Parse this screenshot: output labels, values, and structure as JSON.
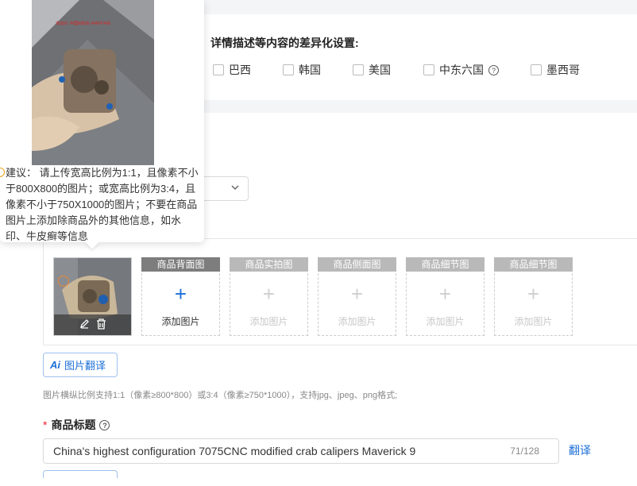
{
  "diff_settings": {
    "title": "详情描述等内容的差异化设置:",
    "countries": [
      {
        "label": "巴西",
        "checked": false
      },
      {
        "label": "韩国",
        "checked": false
      },
      {
        "label": "美国",
        "checked": false
      },
      {
        "label": "中东六国",
        "checked": false
      },
      {
        "label": "墨西哥",
        "checked": false
      }
    ]
  },
  "image_slots": [
    {
      "label": "商品背面图",
      "add_label": "添加图片",
      "active": true
    },
    {
      "label": "商品实拍图",
      "add_label": "添加图片",
      "active": false
    },
    {
      "label": "商品侧面图",
      "add_label": "添加图片",
      "active": false
    },
    {
      "label": "商品细节图",
      "add_label": "添加图片",
      "active": false
    },
    {
      "label": "商品细节图",
      "add_label": "添加图片",
      "active": false
    }
  ],
  "ai_translate": {
    "ai_label": "Ai",
    "label": "图片翻译"
  },
  "image_hint": "图片横纵比例支持1:1（像素≥800*800）或3:4（像素≥750*1000），支持jpg、jpeg、png格式;",
  "product_title": {
    "label": "商品标题",
    "value": "China's highest configuration 7075CNC modified crab calipers Maverick 9",
    "counter": "71/128",
    "translate_label": "翻译"
  },
  "popover": {
    "suggestion": "建议： 请上传宽高比例为1:1，且像素不小于800X800的图片；或宽高比例为3:4，且像素不小于750X1000的图片；不要在商品图片上添加除商品外的其他信息，如水印、牛皮癣等信息",
    "watermark": "淘宝ID: 中国刹车控 #64247426"
  },
  "colors": {
    "accent": "#1d6fd8",
    "required": "#e23333"
  }
}
